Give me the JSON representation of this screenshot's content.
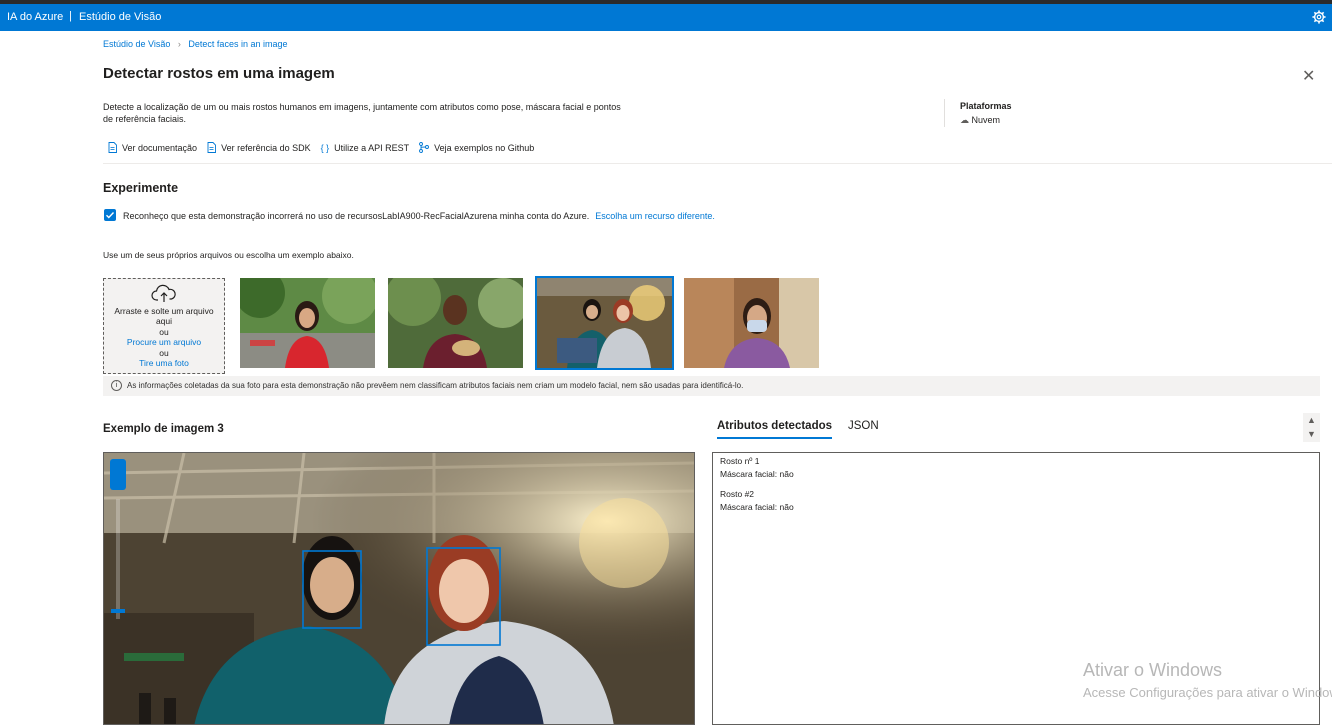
{
  "topbar": {
    "brand": "IA do Azure",
    "separator": "|",
    "studio": "Estúdio de Visão",
    "settings_icon": "gear-icon"
  },
  "breadcrumb": {
    "home": "Estúdio de Visão",
    "current": "Detect faces in an image"
  },
  "page": {
    "title": "Detectar rostos em uma imagem",
    "description": "Detecte a localização de um ou mais rostos humanos em imagens, juntamente com atributos como pose, máscara facial e pontos de referência faciais.",
    "platforms_label": "Plataformas",
    "platforms_value": "Nuvem"
  },
  "links": [
    {
      "label": "Ver documentação",
      "icon": "document-icon"
    },
    {
      "label": "Ver referência do SDK",
      "icon": "document-icon"
    },
    {
      "label": "Utilize a API REST",
      "icon": "braces-icon"
    },
    {
      "label": "Veja exemplos no Github",
      "icon": "branch-icon"
    }
  ],
  "experiment": {
    "heading": "Experimente",
    "ack_text": "Reconheço que esta demonstração incorrerá no uso de recursosLabIA900-RecFacialAzurena minha conta do Azure.",
    "ack_checked": true,
    "choose_resource": "Escolha um recurso diferente.",
    "instructions": "Use um de seus próprios arquivos ou escolha um exemplo abaixo."
  },
  "upload": {
    "drag": "Arraste e solte um arquivo aqui",
    "or1": "ou",
    "browse": "Procure um arquivo",
    "or2": "ou",
    "photo": "Tire uma foto"
  },
  "info": "As informações coletadas da sua foto para esta demonstração não prevêem nem classificam atributos faciais nem criam um modelo facial, nem são usadas para identificá-lo.",
  "sample": {
    "title": "Exemplo de imagem 3",
    "selected_index": 3
  },
  "tabs": {
    "active": "Atributos detectados",
    "other": "JSON"
  },
  "results": [
    {
      "name": "Rosto nº 1",
      "attr": "Máscara facial: não"
    },
    {
      "name": "Rosto #2",
      "attr": "Máscara facial: não"
    }
  ],
  "watermark": {
    "line1": "Ativar o Windows",
    "line2": "Acesse Configurações para ativar o Windows."
  },
  "colors": {
    "accent": "#0078d4",
    "topbar": "#0078d4"
  }
}
